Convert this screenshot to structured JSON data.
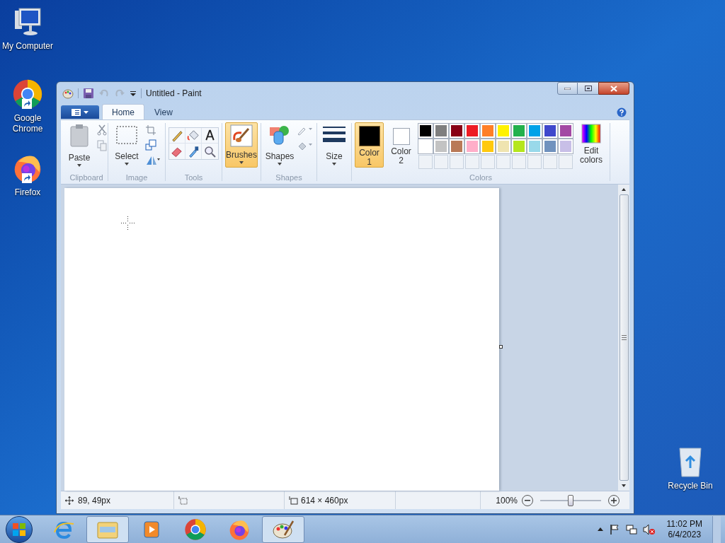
{
  "desktop_icons": [
    {
      "label": "My Computer",
      "kind": "computer"
    },
    {
      "label": "Google Chrome",
      "kind": "chrome"
    },
    {
      "label": "Firefox",
      "kind": "firefox"
    },
    {
      "label": "Recycle Bin",
      "kind": "bin"
    }
  ],
  "window": {
    "title": "Untitled - Paint"
  },
  "tabs": [
    {
      "label": "Home",
      "selected": true
    },
    {
      "label": "View",
      "selected": false
    }
  ],
  "ribbon": {
    "clipboard": {
      "label": "Clipboard",
      "paste": "Paste"
    },
    "image": {
      "label": "Image",
      "select": "Select"
    },
    "tools": {
      "label": "Tools"
    },
    "brushes": {
      "label": "Brushes",
      "selected": true
    },
    "shapes": {
      "label": "Shapes",
      "button": "Shapes"
    },
    "size": {
      "label": "Size"
    },
    "colors": {
      "label": "Colors",
      "slots": [
        {
          "label": "Color 1",
          "selected": true,
          "color": "#000000"
        },
        {
          "label": "Color 2",
          "selected": false,
          "color": "#ffffff"
        }
      ],
      "palette": [
        {
          "color": "#000000"
        },
        {
          "color": "#7f7f7f"
        },
        {
          "color": "#880015"
        },
        {
          "color": "#ed1c24"
        },
        {
          "color": "#ff7f27"
        },
        {
          "color": "#fff200"
        },
        {
          "color": "#22b14c"
        },
        {
          "color": "#00a2e8"
        },
        {
          "color": "#3f48cc"
        },
        {
          "color": "#a349a4"
        },
        {
          "color": "#ffffff"
        },
        {
          "color": "#c3c3c3"
        },
        {
          "color": "#b97a57"
        },
        {
          "color": "#ffaec9"
        },
        {
          "color": "#ffc90e"
        },
        {
          "color": "#efe4b0"
        },
        {
          "color": "#b5e61d"
        },
        {
          "color": "#99d9ea"
        },
        {
          "color": "#7092be"
        },
        {
          "color": "#c8bfe7"
        }
      ],
      "edit": "Edit colors"
    }
  },
  "status_bar": {
    "position": "89, 49px",
    "size": "614 × 460px",
    "zoom": "100%",
    "zoom_slider": {
      "level": 0.5
    }
  },
  "taskbar": {
    "items": [
      {
        "kind": "ie",
        "selected": false
      },
      {
        "kind": "explorer",
        "selected": true
      },
      {
        "kind": "media",
        "selected": false
      },
      {
        "kind": "chrome",
        "selected": false
      },
      {
        "kind": "firefox",
        "selected": false
      },
      {
        "kind": "paint",
        "selected": true
      }
    ],
    "time": "11:02 PM",
    "date": "6/4/2023"
  }
}
